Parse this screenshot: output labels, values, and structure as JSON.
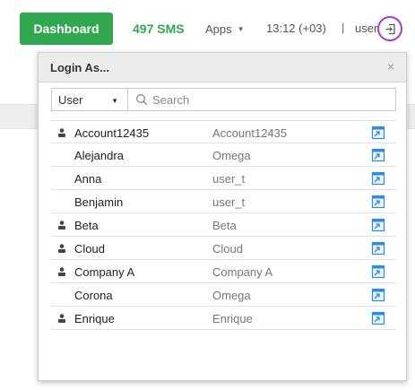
{
  "topbar": {
    "dashboard_label": "Dashboard",
    "sms_label": "497 SMS",
    "apps_label": "Apps",
    "time_label": "13:12 (+03)",
    "separator": "|",
    "user_label": "user",
    "accent_color": "#2fa84f",
    "highlight_color": "#a23ad6"
  },
  "popup": {
    "title": "Login As...",
    "close_glyph": "×",
    "filter": {
      "selected": "User"
    },
    "search": {
      "placeholder": "Search",
      "value": ""
    },
    "rows": [
      {
        "name": "Account12435",
        "company": "Account12435",
        "has_person_icon": true
      },
      {
        "name": "Alejandra",
        "company": "Omega",
        "has_person_icon": false
      },
      {
        "name": "Anna",
        "company": "user_t",
        "has_person_icon": false
      },
      {
        "name": "Benjamin",
        "company": "user_t",
        "has_person_icon": false
      },
      {
        "name": "Beta",
        "company": "Beta",
        "has_person_icon": true
      },
      {
        "name": "Cloud",
        "company": "Cloud",
        "has_person_icon": true
      },
      {
        "name": "Company A",
        "company": "Company A",
        "has_person_icon": true
      },
      {
        "name": "Corona",
        "company": "Omega",
        "has_person_icon": false
      },
      {
        "name": "Enrique",
        "company": "Enrique",
        "has_person_icon": true
      }
    ]
  }
}
